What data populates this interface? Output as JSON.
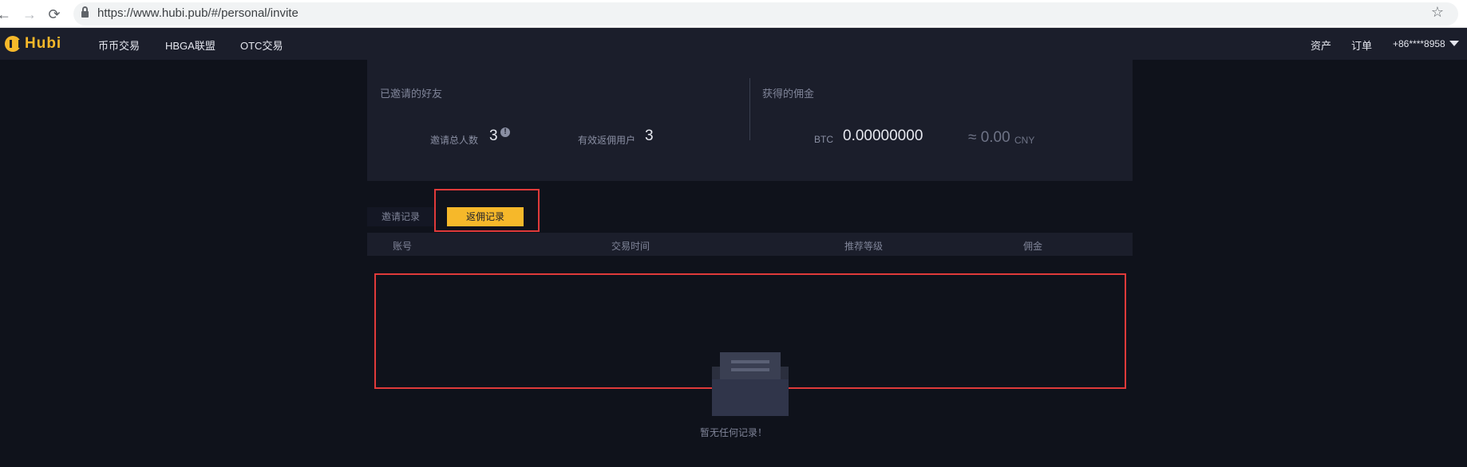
{
  "browser": {
    "url": "https://www.hubi.pub/#/personal/invite",
    "back_icon": "←",
    "forward_icon": "→",
    "reload_icon": "⟳",
    "star_icon": "☆"
  },
  "header": {
    "logo_text": "Hubi",
    "nav": [
      "币币交易",
      "HBGA联盟",
      "OTC交易"
    ],
    "right": {
      "assets": "资产",
      "orders": "订单",
      "account": "+86****8958"
    }
  },
  "stats": {
    "invited_friends_label": "已邀请的好友",
    "total_invites_label": "邀请总人数",
    "total_invites_value": "3",
    "valid_rebate_users_label": "有效返佣用户",
    "valid_rebate_users_value": "3",
    "commission_label": "获得的佣金",
    "btc_unit": "BTC",
    "btc_value": "0.00000000",
    "cny_approx": "≈ 0.00",
    "cny_unit": "CNY"
  },
  "tabs": {
    "invite_records": "邀请记录",
    "rebate_records": "返佣记录"
  },
  "table": {
    "columns": [
      "账号",
      "交易时间",
      "推荐等级",
      "佣金"
    ]
  },
  "empty": {
    "message": "暂无任何记录！"
  },
  "colors": {
    "accent": "#f6b82a",
    "highlight": "#e03a3a",
    "background": "#0f121b",
    "panel": "#1b1e2b"
  }
}
